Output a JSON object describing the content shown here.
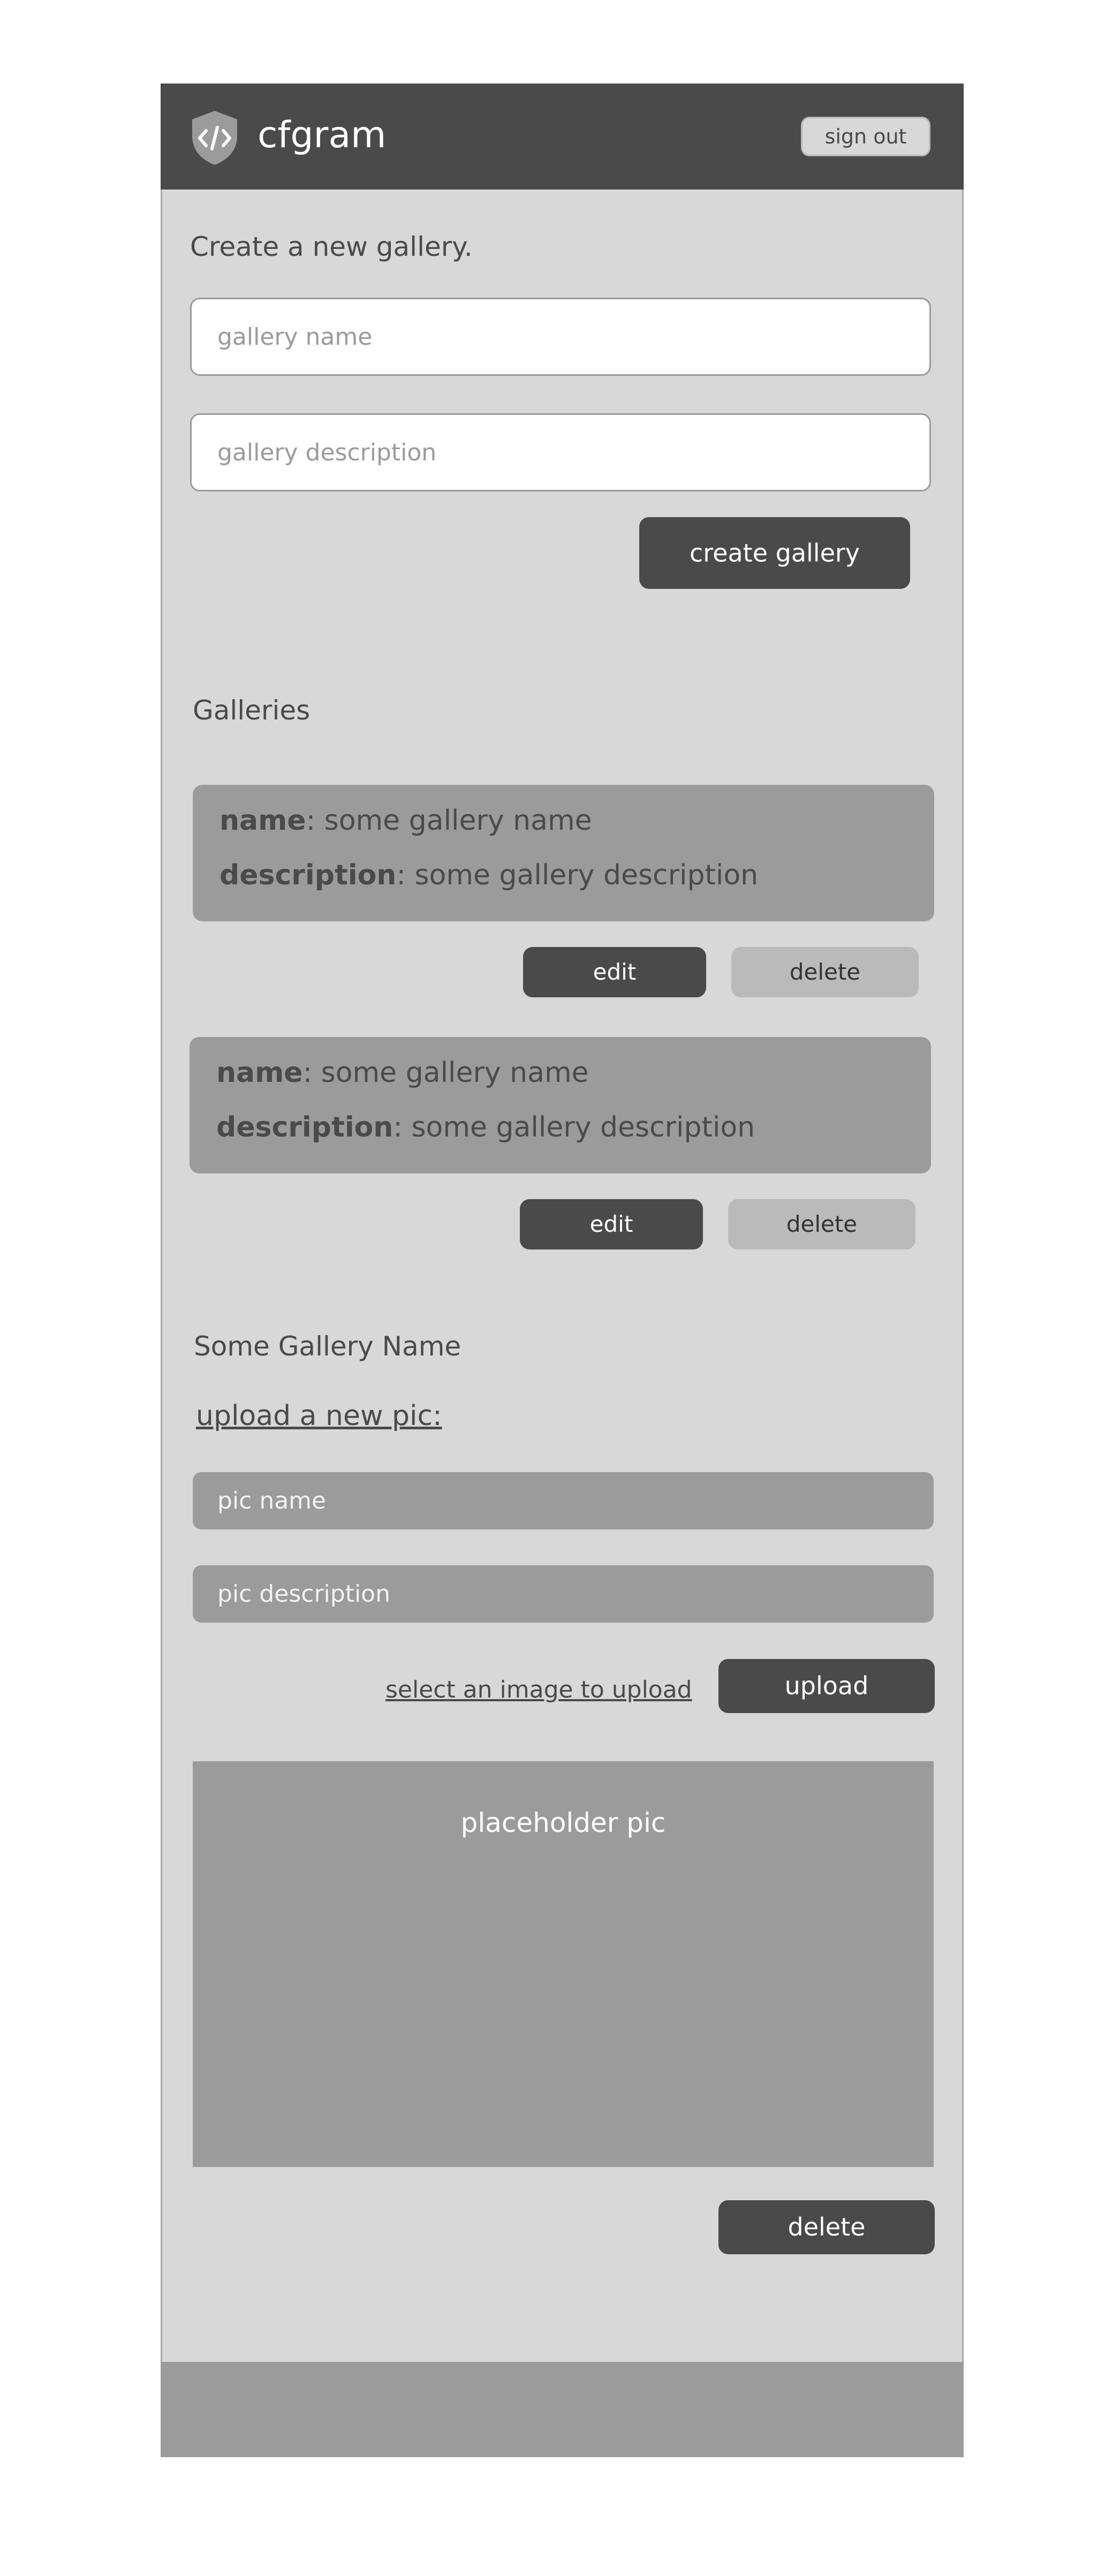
{
  "header": {
    "app_title": "cfgram",
    "logo_icon": "shield-code-icon",
    "sign_out_label": "sign out"
  },
  "create_gallery": {
    "heading": "Create a new gallery.",
    "name_placeholder": "gallery name",
    "description_placeholder": "gallery description",
    "submit_label": "create gallery"
  },
  "galleries": {
    "heading": "Galleries",
    "items": [
      {
        "name_key": "name",
        "name_value": ": some gallery name",
        "description_key": "description",
        "description_value": ": some gallery description",
        "edit_label": "edit",
        "delete_label": "delete"
      },
      {
        "name_key": "name",
        "name_value": ": some gallery name",
        "description_key": "description",
        "description_value": ": some gallery description",
        "edit_label": "edit",
        "delete_label": "delete"
      }
    ]
  },
  "gallery_detail": {
    "title": "Some Gallery Name",
    "upload_heading": "upload a new pic:",
    "pic_name_placeholder": "pic name",
    "pic_description_placeholder": "pic description",
    "select_image_label": "select an image to upload",
    "upload_label": "upload",
    "placeholder_pic_label": "placeholder pic",
    "delete_label": "delete"
  },
  "colors": {
    "header_bg": "#4a4a4a",
    "panel_bg": "#d8d8d8",
    "card_bg": "#9b9b9b",
    "dark_button": "#4a4a4a",
    "light_button": "#bababa"
  }
}
